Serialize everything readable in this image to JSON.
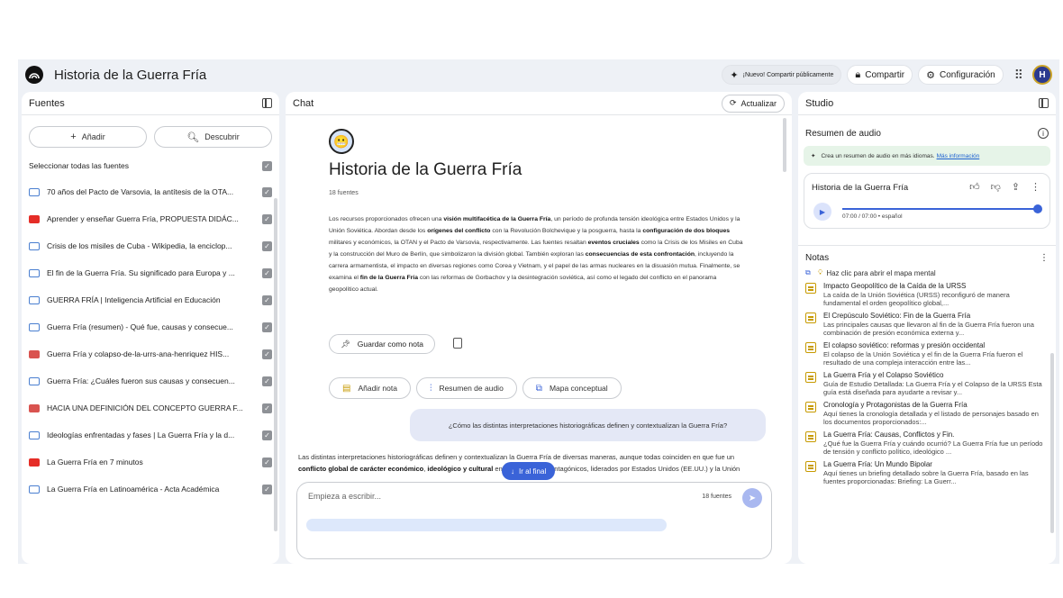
{
  "header": {
    "title": "Historia de la Guerra Fría",
    "new_share": "¡Nuevo! Compartir públicamente",
    "share": "Compartir",
    "settings": "Configuración"
  },
  "sources": {
    "title": "Fuentes",
    "add": "Añadir",
    "discover": "Descubrir",
    "select_all": "Seleccionar todas las fuentes",
    "items": [
      {
        "type": "doc",
        "label": "70 años del Pacto de Varsovia, la antítesis de la OTA..."
      },
      {
        "type": "yt",
        "label": "Aprender y enseñar Guerra Fría, PROPUESTA DIDÁC..."
      },
      {
        "type": "doc",
        "label": "Crisis de los misiles de Cuba - Wikipedia, la enciclop..."
      },
      {
        "type": "doc",
        "label": "El fin de la Guerra Fría. Su significado para Europa y ..."
      },
      {
        "type": "doc",
        "label": "GUERRA FRÍA | Inteligencia Artificial en Educación"
      },
      {
        "type": "doc",
        "label": "Guerra Fría (resumen) - Qué fue, causas y consecue..."
      },
      {
        "type": "pdf",
        "label": "Guerra Fría y colapso-de-la-urrs-ana-henriquez HIS..."
      },
      {
        "type": "doc",
        "label": "Guerra Fría: ¿Cuáles fueron sus causas y consecuen..."
      },
      {
        "type": "pdf",
        "label": "HACIA UNA DEFINICIÓN DEL CONCEPTO GUERRA F..."
      },
      {
        "type": "doc",
        "label": "Ideologías enfrentadas y fases | La Guerra Fría y la d..."
      },
      {
        "type": "yt",
        "label": "La Guerra Fría en 7 minutos"
      },
      {
        "type": "doc",
        "label": "La Guerra Fría en Latinoamérica - Acta Académica"
      }
    ]
  },
  "chat": {
    "title": "Chat",
    "refresh": "Actualizar",
    "notebook_title": "Historia de la Guerra Fría",
    "source_count": "18 fuentes",
    "summary": [
      {
        "t": "Los recursos proporcionados ofrecen una "
      },
      {
        "t": "visión multifacética de la Guerra Fría",
        "b": true
      },
      {
        "t": ", un período de profunda tensión ideológica entre Estados Unidos y la Unión Soviética. Abordan desde los "
      },
      {
        "t": "orígenes del conflicto",
        "b": true
      },
      {
        "t": " con la Revolución Bolchevique y la posguerra, hasta la "
      },
      {
        "t": "configuración de dos bloques",
        "b": true
      },
      {
        "t": " militares y económicos, la OTAN y el Pacto de Varsovia, respectivamente. Las fuentes resaltan "
      },
      {
        "t": "eventos cruciales",
        "b": true
      },
      {
        "t": " como la Crisis de los Misiles en Cuba y la construcción del Muro de Berlín, que simbolizaron la división global. También exploran las "
      },
      {
        "t": "consecuencias de esta confrontación",
        "b": true
      },
      {
        "t": ", incluyendo la carrera armamentista, el impacto en diversas regiones como Corea y Vietnam, y el papel de las armas nucleares en la disuasión mutua. Finalmente, se examina el "
      },
      {
        "t": "fin de la Guerra Fría",
        "b": true
      },
      {
        "t": " con las reformas de Gorbachov y la desintegración soviética, así como el legado del conflicto en el panorama geopolítico actual."
      }
    ],
    "save_note": "Guardar como nota",
    "add_note": "Añadir nota",
    "audio_summary": "Resumen de audio",
    "mind_map": "Mapa conceptual",
    "question": "¿Cómo las distintas interpretaciones historiográficas definen y contextualizan la Guerra Fría?",
    "answer": [
      {
        "t": "Las distintas interpretaciones historiográficas definen y contextualizan la Guerra Fría de diversas maneras, aunque todas coinciden en que fue un "
      },
      {
        "t": "conflicto global de carácter económico",
        "b": true
      },
      {
        "t": ", "
      },
      {
        "t": "ideológico y cultural",
        "b": true
      },
      {
        "t": " entre dos bloques antagónicos, liderados por Estados Unidos (EE.UU.) y la Unión Soviética (URSS). Se la denomina \"Fría\" porque..."
      }
    ],
    "jump": "Ir al final",
    "input_placeholder": "Empieza a escribir...",
    "input_sources": "18 fuentes"
  },
  "studio": {
    "title": "Studio",
    "audio_section": "Resumen de audio",
    "banner": "Crea un resumen de audio en más idiomas.",
    "banner_link": "Más información",
    "audio_title": "Historia de la Guerra Fría",
    "audio_time": "07:00 / 07:00 • español",
    "audio_progress": 1.0,
    "notes_title": "Notas",
    "mind_map_hint": "Haz clic para abrir el mapa mental",
    "notes": [
      {
        "title": "Impacto Geopolítico de la Caída de la URSS",
        "desc": "La caída de la Unión Soviética (URSS) reconfiguró de manera fundamental el orden geopolítico global,..."
      },
      {
        "title": "El Crepúsculo Soviético: Fin de la Guerra Fría",
        "desc": "Las principales causas que llevaron al fin de la Guerra Fría fueron una combinación de presión económica externa y..."
      },
      {
        "title": "El colapso soviético: reformas y presión occidental",
        "desc": "El colapso de la Unión Soviética y el fin de la Guerra Fría fueron el resultado de una compleja interacción entre las..."
      },
      {
        "title": "La Guerra Fría y el Colapso Soviético",
        "desc": "Guía de Estudio Detallada: La Guerra Fría y el Colapso de la URSS Esta guía está diseñada para ayudarte a revisar y..."
      },
      {
        "title": "Cronología y Protagonistas de la Guerra Fría",
        "desc": "Aquí tienes la cronología detallada y el listado de personajes basado en los documentos proporcionados:..."
      },
      {
        "title": "La Guerra Fría: Causas, Conflictos y Fin.",
        "desc": "¿Qué fue la Guerra Fría y cuándo ocurrió? La Guerra Fría fue un período de tensión y conflicto político, ideológico ..."
      },
      {
        "title": "La Guerra Fría: Un Mundo Bipolar",
        "desc": "Aquí tienes un briefing detallado sobre la Guerra Fría, basado en las fuentes proporcionadas: Briefing: La Guerr..."
      }
    ]
  }
}
